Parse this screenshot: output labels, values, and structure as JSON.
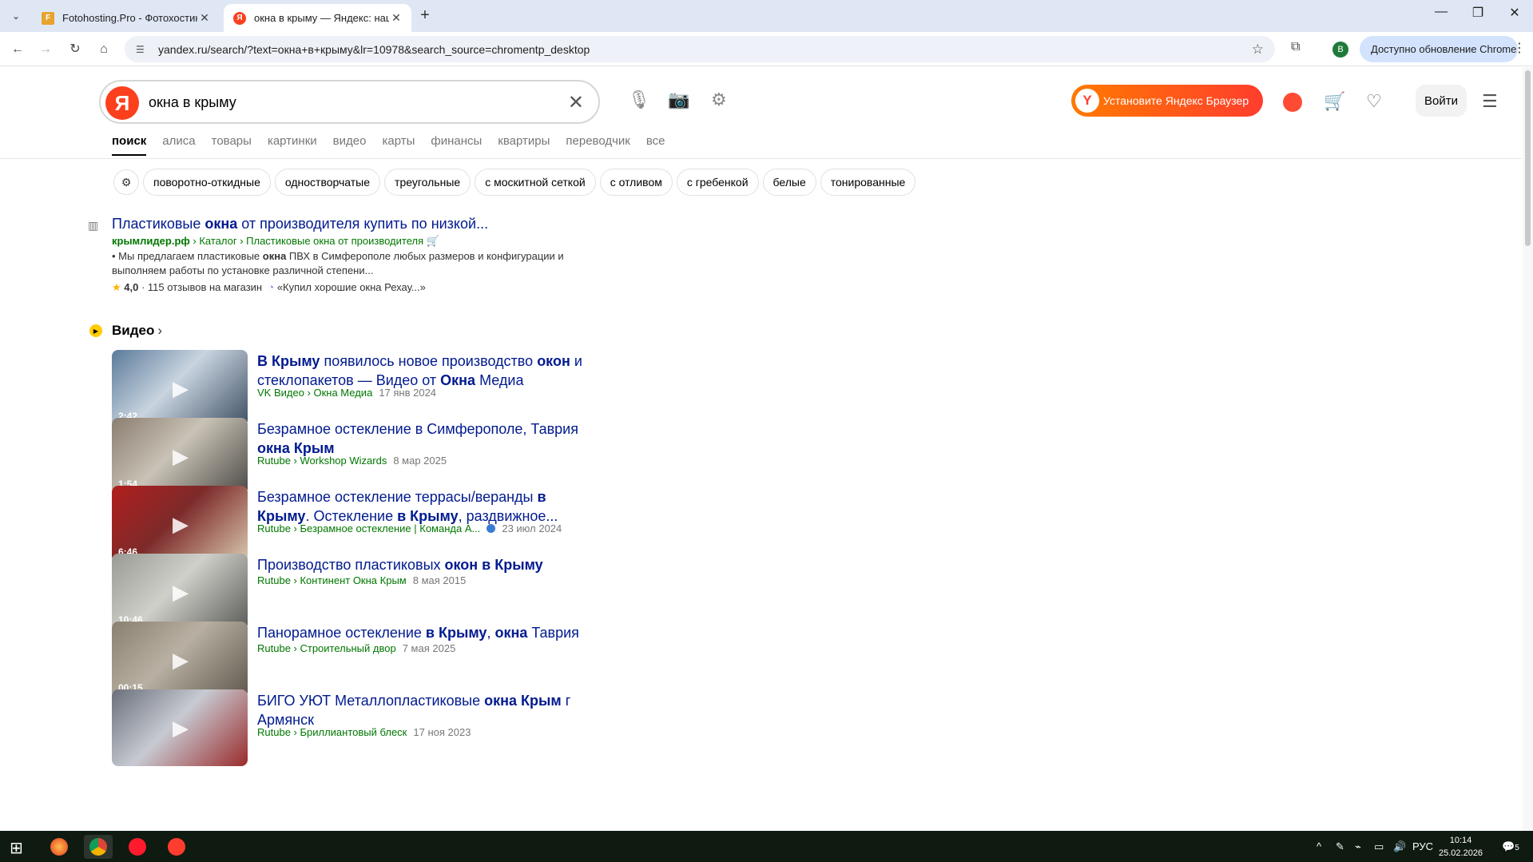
{
  "browser": {
    "tabs": [
      {
        "title": "Fotohosting.Pro - Фотохостинг",
        "favicon_color": "#e7a32c"
      },
      {
        "title": "окна в крыму — Яндекс: нашлось",
        "favicon_color": "#fc3f1d"
      }
    ],
    "url": "yandex.ru/search/?text=окна+в+крыму&lr=10978&search_source=chromentp_desktop",
    "profile_letter": "B",
    "update_label": "Доступно обновление Chrome"
  },
  "search": {
    "logo_letter": "Я",
    "query": "окна в крыму",
    "install_label": "Установите Яндекс Браузер",
    "install_logo": "Y",
    "login_label": "Войти"
  },
  "nav_tabs": [
    "поиск",
    "алиса",
    "товары",
    "картинки",
    "видео",
    "карты",
    "финансы",
    "квартиры",
    "переводчик",
    "все"
  ],
  "chips": [
    "поворотно-откидные",
    "одностворчатые",
    "треугольные",
    "с москитной сеткой",
    "с отливом",
    "с гребенкой",
    "белые",
    "тонированные"
  ],
  "result1": {
    "title_pre": "Пластиковые ",
    "title_bold": "окна",
    "title_post": " от производителя купить по низкой...",
    "domain": "крымлидер.рф",
    "path": " › Каталог › Пластиковые окна от производителя",
    "snippet_pre": "• Мы предлагаем пластиковые ",
    "snippet_bold": "окна",
    "snippet_post": " ПВХ в Симферополе любых размеров и конфигурации и выполняем работы по установке различной степени...",
    "rating": "4,0",
    "reviews": " · 115 отзывов на магазин",
    "quote": "«Купил хорошие окна Рехау...»"
  },
  "video_section": {
    "title": "Видео"
  },
  "videos": [
    {
      "title_html": "<b>В Крыму</b> появилось новое производство <b>окон</b> и стеклопакетов — Видео от <b>Окна</b> Медиа",
      "source": "VK Видео › Окна Медиа",
      "date": "17 янв 2024",
      "duration": "2:42",
      "thumb": "linear-gradient(135deg,#5a7a99,#c9d4e0 45%,#3d4f63)",
      "verified": false,
      "lines": 2
    },
    {
      "title_html": "Безрамное остекление в Симферополе, Таврия <b>окна Крым</b>",
      "source": "Rutube › Workshop Wizards",
      "date": "8 мар 2025",
      "duration": "1:54",
      "thumb": "linear-gradient(135deg,#8a7e70,#c9c2b6 45%,#4b4a46)",
      "verified": false,
      "lines": 2
    },
    {
      "title_html": "Безрамное остекление террасы/веранды <b>в Крыму</b>. Остекление <b>в Крыму</b>, раздвижное...",
      "source": "Rutube › Безрамное остекление | Команда А...",
      "date": "23 июл 2024",
      "duration": "6:46",
      "thumb": "linear-gradient(135deg,#b21e1e,#7d2a2a 45%,#d9c9b0)",
      "verified": true,
      "lines": 2
    },
    {
      "title_html": "Производство пластиковых <b>окон в Крыму</b>",
      "source": "Rutube › Континент Окна Крым",
      "date": "8 мая 2015",
      "duration": "10:46",
      "thumb": "linear-gradient(135deg,#9a9a95,#d0d0cb 45%,#5a5a56)",
      "verified": false,
      "lines": 1
    },
    {
      "title_html": "Панорамное остекление <b>в Крыму</b>, <b>окна</b> Таврия",
      "source": "Rutube › Строительный двор",
      "date": "7 мая 2025",
      "duration": "00:15",
      "thumb": "linear-gradient(135deg,#8a8070,#b8b0a2 45%,#5e574c)",
      "verified": false,
      "lines": 1
    },
    {
      "title_html": "БИГО УЮТ Металлопластиковые <b>окна Крым</b> г Армянск",
      "source": "Rutube › Бриллиантовый блеск",
      "date": "17 ноя 2023",
      "duration": "",
      "thumb": "linear-gradient(135deg,#6a6f7a,#c7cad2 45%,#9a2b2b)",
      "verified": false,
      "lines": 2
    }
  ],
  "taskbar": {
    "lang": "РУС",
    "time": "10:14",
    "date": "25.02.2026",
    "notifications": "5"
  }
}
